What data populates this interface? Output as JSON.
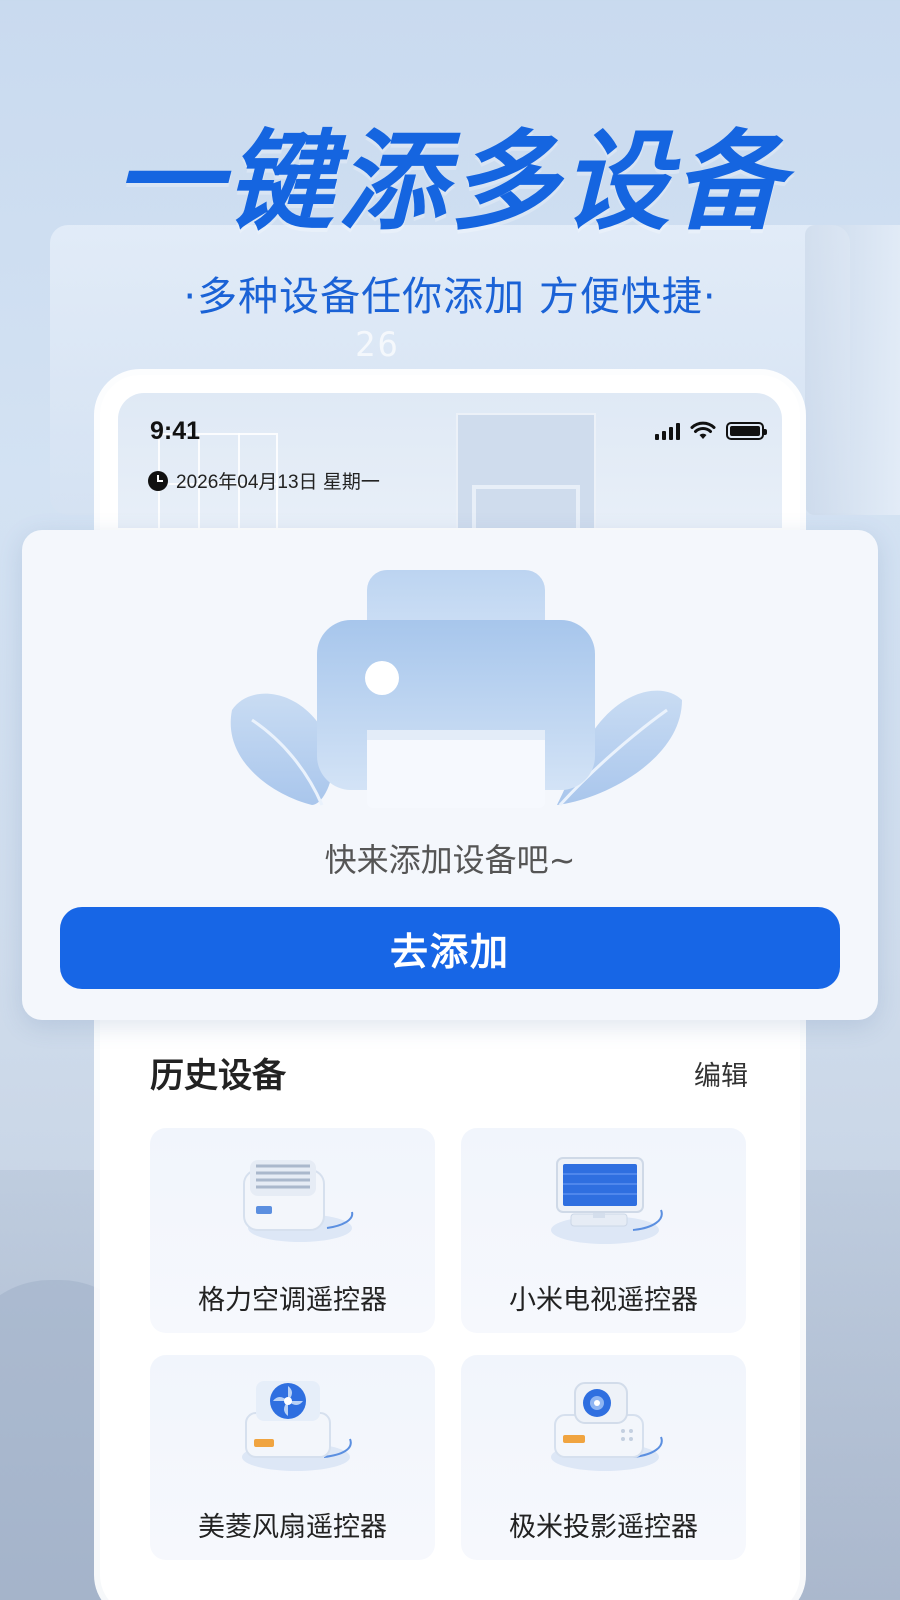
{
  "hero": {
    "title": "一键添多设备",
    "subtitle": "·多种设备任你添加 方便快捷·",
    "background_temp": "26"
  },
  "status_bar": {
    "time": "9:41",
    "date": "2026年04月13日  星期一"
  },
  "add_card": {
    "empty_message": "快来添加设备吧~",
    "add_button_label": "去添加"
  },
  "history": {
    "title": "历史设备",
    "edit_label": "编辑",
    "devices": [
      {
        "label": "格力空调遥控器",
        "icon": "air-conditioner-icon"
      },
      {
        "label": "小米电视遥控器",
        "icon": "tv-icon"
      },
      {
        "label": "美菱风扇遥控器",
        "icon": "fan-icon"
      },
      {
        "label": "极米投影遥控器",
        "icon": "projector-icon"
      }
    ]
  },
  "colors": {
    "accent": "#1766e6",
    "hero_text": "#1565e0",
    "card_bg": "#f4f7fc"
  }
}
